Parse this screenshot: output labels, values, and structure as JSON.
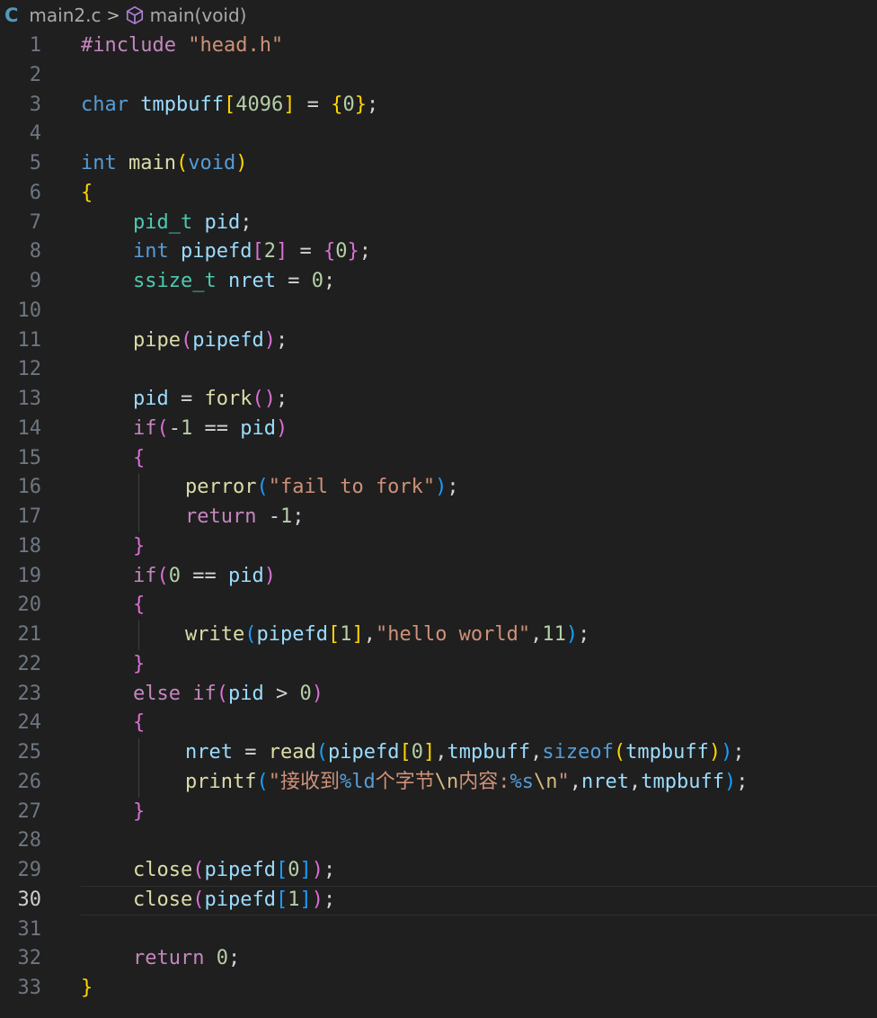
{
  "breadcrumb": {
    "lang_icon": "C",
    "file": "main2.c",
    "separator": ">",
    "symbol_icon": "cube-icon",
    "symbol": "main(void)"
  },
  "editor": {
    "current_line": 30,
    "lines": [
      {
        "n": "1",
        "indent": 0,
        "tokens": [
          [
            "#include ",
            "ctl"
          ],
          [
            "\"head.h\"",
            "str"
          ]
        ]
      },
      {
        "n": "2",
        "indent": 0,
        "tokens": []
      },
      {
        "n": "3",
        "indent": 0,
        "tokens": [
          [
            "char",
            "kw"
          ],
          [
            " ",
            "op"
          ],
          [
            "tmpbuff",
            "var"
          ],
          [
            "[",
            "b1"
          ],
          [
            "4096",
            "num"
          ],
          [
            "]",
            "b1"
          ],
          [
            " = ",
            "op"
          ],
          [
            "{",
            "b1"
          ],
          [
            "0",
            "num"
          ],
          [
            "}",
            "b1"
          ],
          [
            ";",
            "op"
          ]
        ]
      },
      {
        "n": "4",
        "indent": 0,
        "tokens": []
      },
      {
        "n": "5",
        "indent": 0,
        "tokens": [
          [
            "int",
            "kw"
          ],
          [
            " ",
            "op"
          ],
          [
            "main",
            "fn"
          ],
          [
            "(",
            "b1"
          ],
          [
            "void",
            "kw"
          ],
          [
            ")",
            "b1"
          ]
        ]
      },
      {
        "n": "6",
        "indent": 0,
        "tokens": [
          [
            "{",
            "b1 match"
          ]
        ]
      },
      {
        "n": "7",
        "indent": 1,
        "tokens": [
          [
            "pid_t",
            "typ"
          ],
          [
            " ",
            "op"
          ],
          [
            "pid",
            "var"
          ],
          [
            ";",
            "op"
          ]
        ]
      },
      {
        "n": "8",
        "indent": 1,
        "tokens": [
          [
            "int",
            "kw"
          ],
          [
            " ",
            "op"
          ],
          [
            "pipefd",
            "var"
          ],
          [
            "[",
            "b2"
          ],
          [
            "2",
            "num"
          ],
          [
            "]",
            "b2"
          ],
          [
            " = ",
            "op"
          ],
          [
            "{",
            "b2"
          ],
          [
            "0",
            "num"
          ],
          [
            "}",
            "b2"
          ],
          [
            ";",
            "op"
          ]
        ]
      },
      {
        "n": "9",
        "indent": 1,
        "tokens": [
          [
            "ssize_t",
            "typ"
          ],
          [
            " ",
            "op"
          ],
          [
            "nret",
            "var"
          ],
          [
            " = ",
            "op"
          ],
          [
            "0",
            "num"
          ],
          [
            ";",
            "op"
          ]
        ]
      },
      {
        "n": "10",
        "indent": 0,
        "tokens": []
      },
      {
        "n": "11",
        "indent": 1,
        "tokens": [
          [
            "pipe",
            "fn"
          ],
          [
            "(",
            "b2"
          ],
          [
            "pipefd",
            "var"
          ],
          [
            ")",
            "b2"
          ],
          [
            ";",
            "op"
          ]
        ]
      },
      {
        "n": "12",
        "indent": 0,
        "tokens": []
      },
      {
        "n": "13",
        "indent": 1,
        "tokens": [
          [
            "pid",
            "var"
          ],
          [
            " = ",
            "op"
          ],
          [
            "fork",
            "fn"
          ],
          [
            "(",
            "b2"
          ],
          [
            ")",
            "b2"
          ],
          [
            ";",
            "op"
          ]
        ]
      },
      {
        "n": "14",
        "indent": 1,
        "tokens": [
          [
            "if",
            "ctl"
          ],
          [
            "(",
            "b2"
          ],
          [
            "-",
            "op"
          ],
          [
            "1",
            "num"
          ],
          [
            " == ",
            "op"
          ],
          [
            "pid",
            "var"
          ],
          [
            ")",
            "b2"
          ]
        ]
      },
      {
        "n": "15",
        "indent": 1,
        "tokens": [
          [
            "{",
            "b2"
          ]
        ]
      },
      {
        "n": "16",
        "indent": 2,
        "tokens": [
          [
            "perror",
            "fn"
          ],
          [
            "(",
            "b3"
          ],
          [
            "\"fail to fork\"",
            "str"
          ],
          [
            ")",
            "b3"
          ],
          [
            ";",
            "op"
          ]
        ]
      },
      {
        "n": "17",
        "indent": 2,
        "tokens": [
          [
            "return",
            "ctl"
          ],
          [
            " ",
            "op"
          ],
          [
            "-",
            "op"
          ],
          [
            "1",
            "num"
          ],
          [
            ";",
            "op"
          ]
        ]
      },
      {
        "n": "18",
        "indent": 1,
        "tokens": [
          [
            "}",
            "b2"
          ]
        ]
      },
      {
        "n": "19",
        "indent": 1,
        "tokens": [
          [
            "if",
            "ctl"
          ],
          [
            "(",
            "b2"
          ],
          [
            "0",
            "num"
          ],
          [
            " == ",
            "op"
          ],
          [
            "pid",
            "var"
          ],
          [
            ")",
            "b2"
          ]
        ]
      },
      {
        "n": "20",
        "indent": 1,
        "tokens": [
          [
            "{",
            "b2"
          ]
        ]
      },
      {
        "n": "21",
        "indent": 2,
        "tokens": [
          [
            "write",
            "fn"
          ],
          [
            "(",
            "b3"
          ],
          [
            "pipefd",
            "var"
          ],
          [
            "[",
            "b1"
          ],
          [
            "1",
            "num"
          ],
          [
            "]",
            "b1"
          ],
          [
            ",",
            "op"
          ],
          [
            "\"hello world\"",
            "str"
          ],
          [
            ",",
            "op"
          ],
          [
            "11",
            "num"
          ],
          [
            ")",
            "b3"
          ],
          [
            ";",
            "op"
          ]
        ]
      },
      {
        "n": "22",
        "indent": 1,
        "tokens": [
          [
            "}",
            "b2"
          ]
        ]
      },
      {
        "n": "23",
        "indent": 1,
        "tokens": [
          [
            "else",
            "ctl"
          ],
          [
            " ",
            "op"
          ],
          [
            "if",
            "ctl"
          ],
          [
            "(",
            "b2"
          ],
          [
            "pid",
            "var"
          ],
          [
            " > ",
            "op"
          ],
          [
            "0",
            "num"
          ],
          [
            ")",
            "b2"
          ]
        ]
      },
      {
        "n": "24",
        "indent": 1,
        "tokens": [
          [
            "{",
            "b2"
          ]
        ]
      },
      {
        "n": "25",
        "indent": 2,
        "tokens": [
          [
            "nret",
            "var"
          ],
          [
            " = ",
            "op"
          ],
          [
            "read",
            "fn"
          ],
          [
            "(",
            "b3"
          ],
          [
            "pipefd",
            "var"
          ],
          [
            "[",
            "b1"
          ],
          [
            "0",
            "num"
          ],
          [
            "]",
            "b1"
          ],
          [
            ",",
            "op"
          ],
          [
            "tmpbuff",
            "var"
          ],
          [
            ",",
            "op"
          ],
          [
            "sizeof",
            "kw"
          ],
          [
            "(",
            "b1"
          ],
          [
            "tmpbuff",
            "var"
          ],
          [
            ")",
            "b1"
          ],
          [
            ")",
            "b3"
          ],
          [
            ";",
            "op"
          ]
        ]
      },
      {
        "n": "26",
        "indent": 2,
        "tokens": [
          [
            "printf",
            "fn"
          ],
          [
            "(",
            "b3"
          ],
          [
            "\"接收到",
            "str"
          ],
          [
            "%ld",
            "kw"
          ],
          [
            "个字节",
            "str"
          ],
          [
            "\\n",
            "esc"
          ],
          [
            "内容:",
            "str"
          ],
          [
            "%s",
            "kw"
          ],
          [
            "\\n",
            "esc"
          ],
          [
            "\"",
            "str"
          ],
          [
            ",",
            "op"
          ],
          [
            "nret",
            "var"
          ],
          [
            ",",
            "op"
          ],
          [
            "tmpbuff",
            "var"
          ],
          [
            ")",
            "b3"
          ],
          [
            ";",
            "op"
          ]
        ]
      },
      {
        "n": "27",
        "indent": 1,
        "tokens": [
          [
            "}",
            "b2"
          ]
        ]
      },
      {
        "n": "28",
        "indent": 0,
        "tokens": []
      },
      {
        "n": "29",
        "indent": 1,
        "tokens": [
          [
            "close",
            "fn"
          ],
          [
            "(",
            "b2"
          ],
          [
            "pipefd",
            "var"
          ],
          [
            "[",
            "b3"
          ],
          [
            "0",
            "num"
          ],
          [
            "]",
            "b3"
          ],
          [
            ")",
            "b2"
          ],
          [
            ";",
            "op"
          ]
        ]
      },
      {
        "n": "30",
        "indent": 1,
        "tokens": [
          [
            "close",
            "fn"
          ],
          [
            "(",
            "b2"
          ],
          [
            "pipefd",
            "var"
          ],
          [
            "[",
            "b3"
          ],
          [
            "1",
            "num"
          ],
          [
            "]",
            "b3"
          ],
          [
            ")",
            "b2"
          ],
          [
            ";",
            "op"
          ]
        ]
      },
      {
        "n": "31",
        "indent": 0,
        "tokens": []
      },
      {
        "n": "32",
        "indent": 1,
        "tokens": [
          [
            "return",
            "ctl"
          ],
          [
            " ",
            "op"
          ],
          [
            "0",
            "num"
          ],
          [
            ";",
            "op"
          ]
        ]
      },
      {
        "n": "33",
        "indent": 0,
        "tokens": [
          [
            "}",
            "b1 match"
          ]
        ]
      }
    ]
  }
}
